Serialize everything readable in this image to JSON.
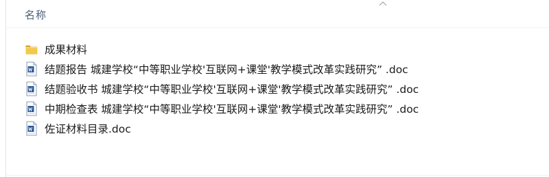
{
  "header": {
    "name_column": "名称"
  },
  "files": [
    {
      "name": "成果材料",
      "type": "folder",
      "icon": "folder-icon"
    },
    {
      "name": "结题报告  城建学校“中等职业学校'互联网+课堂'教学模式改革实践研究” .doc",
      "type": "doc",
      "icon": "word-doc-icon"
    },
    {
      "name": "结题验收书  城建学校“中等职业学校'互联网+课堂'教学模式改革实践研究” .doc",
      "type": "doc",
      "icon": "word-doc-icon"
    },
    {
      "name": "中期检查表  城建学校“中等职业学校'互联网+课堂'教学模式改革实践研究” .doc",
      "type": "doc",
      "icon": "word-doc-icon"
    },
    {
      "name": "佐证材料目录.doc",
      "type": "doc",
      "icon": "word-doc-icon"
    }
  ],
  "colors": {
    "header_text": "#4c607a",
    "folder": "#e8b93a",
    "doc_accent": "#2b5797"
  }
}
